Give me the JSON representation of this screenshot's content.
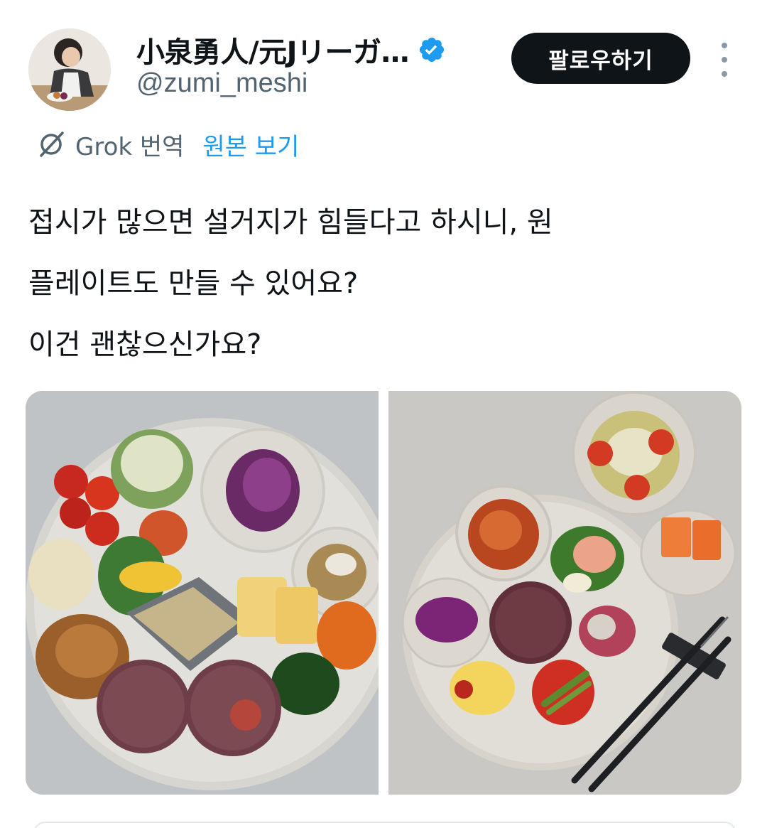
{
  "tweet": {
    "author_name": "小泉勇人/元Jリーガ…",
    "handle": "@zumi_meshi",
    "follow_label": "팔로우하기",
    "translation_label": "Grok 번역",
    "show_original_label": "원본 보기",
    "text_lines": [
      "접시가 많으면 설거지가 힘들다고 하시니, 원",
      "플레이트도 만들 수 있어요?",
      "이건 괜찮으신가요?"
    ]
  },
  "icons": {
    "verified": "verified-badge-icon",
    "grok": "grok-icon",
    "more": "more-options-icon"
  },
  "colors": {
    "text": "#0f1419",
    "secondary": "#536471",
    "accent": "#1d9bf0",
    "follow_bg": "#0f1419"
  }
}
